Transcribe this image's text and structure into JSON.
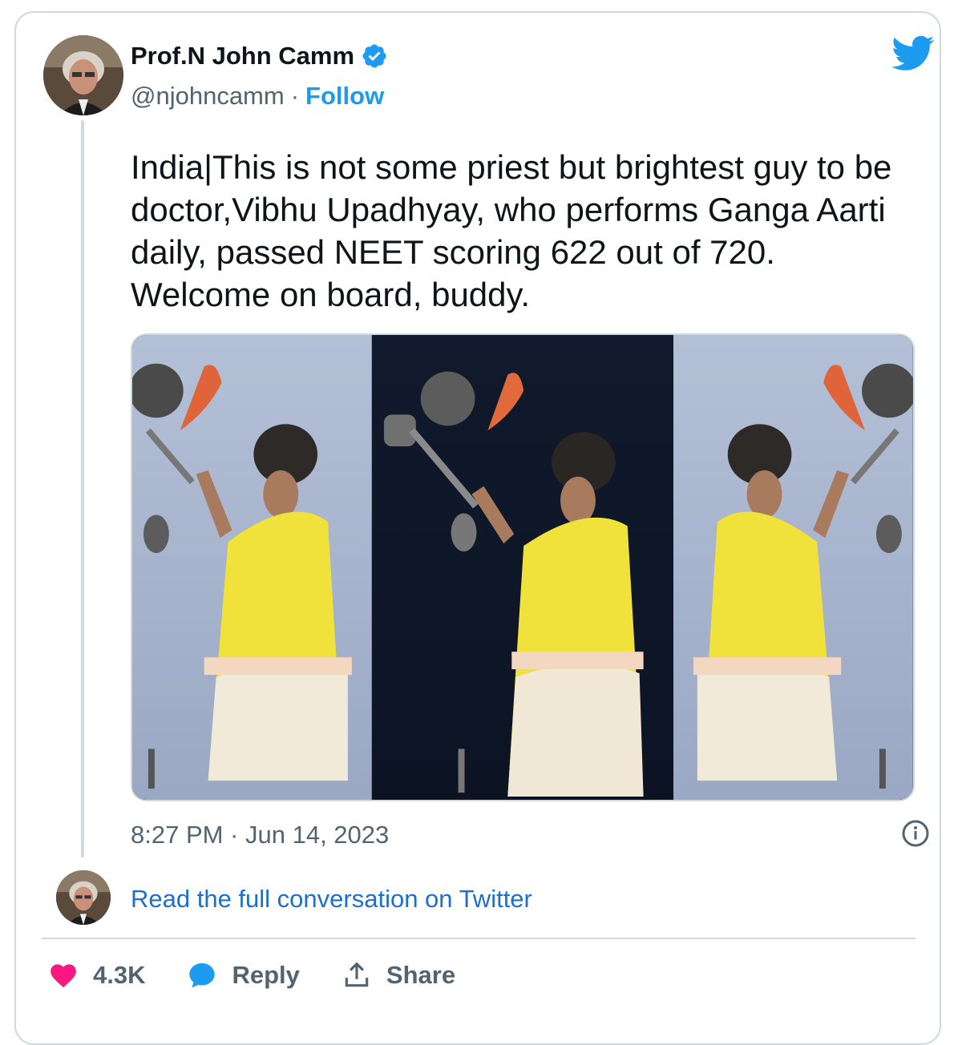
{
  "tweet": {
    "author_name": "Prof.N John Camm",
    "handle": "@njohncamm",
    "separator": "·",
    "follow_label": "Follow",
    "text": "India|This is not some priest but brightest guy to be\ndoctor,Vibhu Upadhyay, who performs Ganga Aarti\ndaily, passed NEET scoring 622 out of 720.\nWelcome on board, buddy.",
    "timestamp": "8:27 PM · Jun 14, 2023",
    "read_more": "Read the full conversation on Twitter"
  },
  "actions": {
    "likes": "4.3K",
    "reply_label": "Reply",
    "share_label": "Share"
  },
  "colors": {
    "accent": "#1d9bf0",
    "link": "#1d6fcf",
    "heart": "#f91880",
    "muted": "#536471",
    "border": "#cfd9de"
  },
  "icons": [
    "verified-badge-icon",
    "twitter-bird-icon",
    "info-icon",
    "heart-icon",
    "reply-bubble-icon",
    "share-icon"
  ]
}
